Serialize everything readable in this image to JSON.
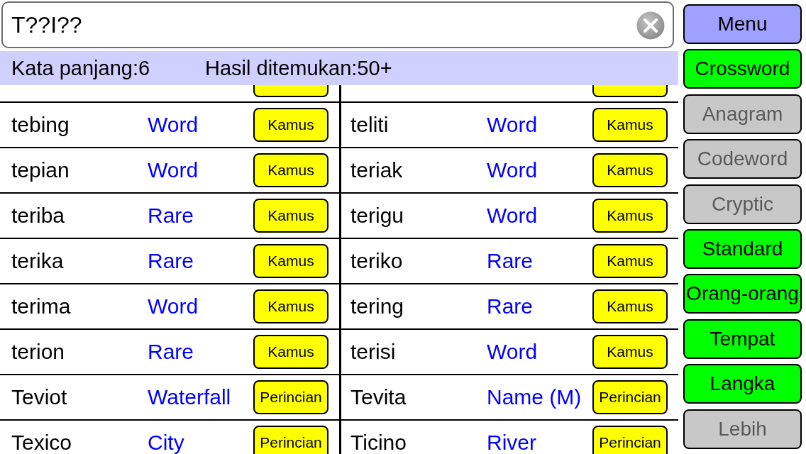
{
  "search": {
    "value": "T??I??"
  },
  "info_bar": {
    "word_length": "Kata panjang:6",
    "results_found": "Hasil ditemukan:50+"
  },
  "results": {
    "cut_off_top_row": true,
    "rows": [
      {
        "cells": [
          {
            "word": "tebing",
            "category": "Word",
            "action": "Kamus"
          },
          {
            "word": "teliti",
            "category": "Word",
            "action": "Kamus"
          }
        ]
      },
      {
        "cells": [
          {
            "word": "tepian",
            "category": "Word",
            "action": "Kamus"
          },
          {
            "word": "teriak",
            "category": "Word",
            "action": "Kamus"
          }
        ]
      },
      {
        "cells": [
          {
            "word": "teriba",
            "category": "Rare",
            "action": "Kamus"
          },
          {
            "word": "terigu",
            "category": "Word",
            "action": "Kamus"
          }
        ]
      },
      {
        "cells": [
          {
            "word": "terika",
            "category": "Rare",
            "action": "Kamus"
          },
          {
            "word": "teriko",
            "category": "Rare",
            "action": "Kamus"
          }
        ]
      },
      {
        "cells": [
          {
            "word": "terima",
            "category": "Word",
            "action": "Kamus"
          },
          {
            "word": "tering",
            "category": "Rare",
            "action": "Kamus"
          }
        ]
      },
      {
        "cells": [
          {
            "word": "terion",
            "category": "Rare",
            "action": "Kamus"
          },
          {
            "word": "terisi",
            "category": "Word",
            "action": "Kamus"
          }
        ]
      },
      {
        "cells": [
          {
            "word": "Teviot",
            "category": "Waterfall",
            "action": "Perincian"
          },
          {
            "word": "Tevita",
            "category": "Name (M)",
            "action": "Perincian"
          }
        ]
      },
      {
        "cells": [
          {
            "word": "Texico",
            "category": "City",
            "action": "Perincian"
          },
          {
            "word": "Ticino",
            "category": "River",
            "action": "Perincian"
          }
        ]
      }
    ]
  },
  "sidebar": {
    "menu_button": {
      "label": "Menu"
    },
    "filters": [
      {
        "label": "Crossword",
        "on": true
      },
      {
        "label": "Anagram",
        "on": false
      },
      {
        "label": "Codeword",
        "on": false
      },
      {
        "label": "Cryptic",
        "on": false
      },
      {
        "label": "Standard",
        "on": true
      },
      {
        "label": "Orang-orang",
        "on": true
      },
      {
        "label": "Tempat",
        "on": true
      },
      {
        "label": "Langka",
        "on": true
      },
      {
        "label": "Lebih",
        "on": false
      }
    ]
  }
}
